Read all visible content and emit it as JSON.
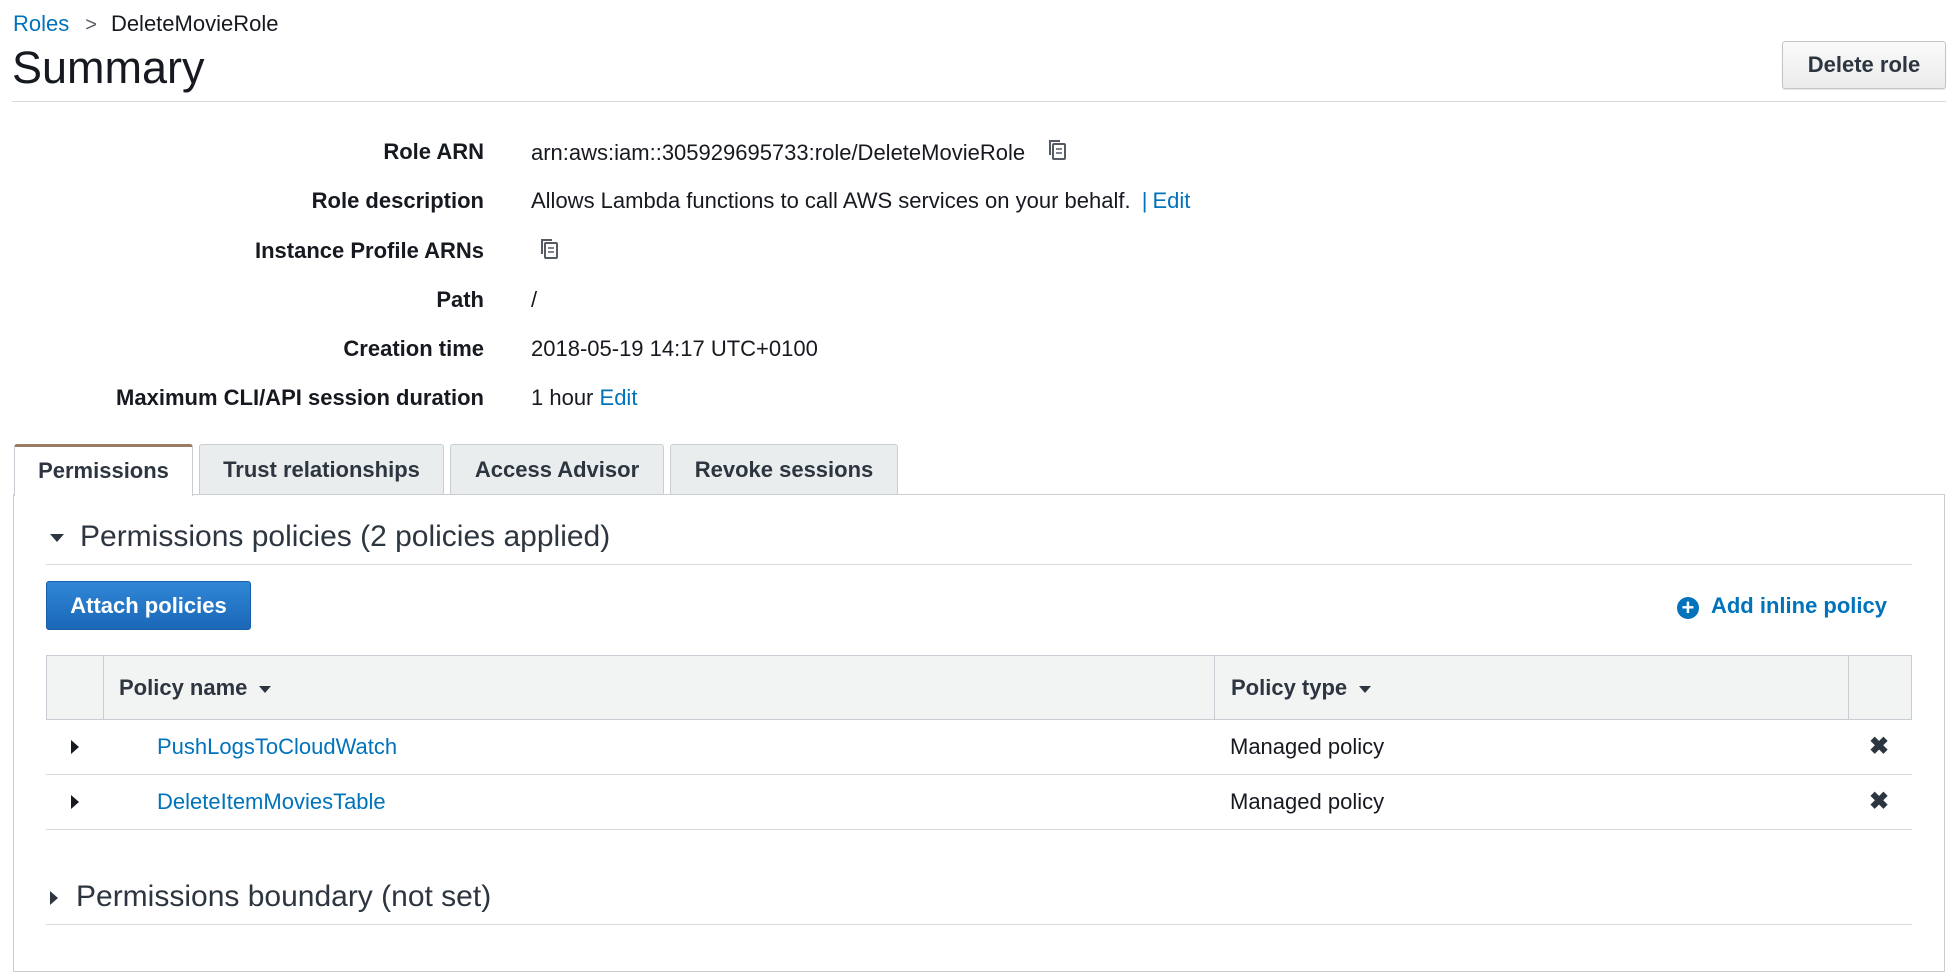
{
  "breadcrumb": {
    "parent": "Roles",
    "separator": ">",
    "current": "DeleteMovieRole"
  },
  "header": {
    "title": "Summary",
    "delete_button": "Delete role"
  },
  "summary": {
    "role_arn": {
      "label": "Role ARN",
      "value": "arn:aws:iam::305929695733:role/DeleteMovieRole"
    },
    "role_description": {
      "label": "Role description",
      "value": "Allows Lambda functions to call AWS services on your behalf.",
      "pipe": "|",
      "edit": "Edit"
    },
    "instance_profile": {
      "label": "Instance Profile ARNs"
    },
    "path": {
      "label": "Path",
      "value": "/"
    },
    "creation_time": {
      "label": "Creation time",
      "value": "2018-05-19 14:17 UTC+0100"
    },
    "max_session": {
      "label": "Maximum CLI/API session duration",
      "value": "1 hour",
      "edit": "Edit"
    }
  },
  "tabs": [
    "Permissions",
    "Trust relationships",
    "Access Advisor",
    "Revoke sessions"
  ],
  "active_tab": "Permissions",
  "permissions": {
    "policies_heading": "Permissions policies (2 policies applied)",
    "attach_button": "Attach policies",
    "add_inline": "Add inline policy",
    "columns": {
      "name": "Policy name",
      "type": "Policy type"
    },
    "rows": [
      {
        "name": "PushLogsToCloudWatch",
        "type": "Managed policy"
      },
      {
        "name": "DeleteItemMoviesTable",
        "type": "Managed policy"
      }
    ],
    "boundary_heading": "Permissions boundary (not set)"
  },
  "icons": {
    "copy": "copy-icon",
    "remove": "remove-x-icon",
    "add": "plus-circle-icon"
  },
  "colors": {
    "link": "#0073bb",
    "primary_button": "#1b67b8",
    "active_tab_accent": "#9b7b62"
  }
}
